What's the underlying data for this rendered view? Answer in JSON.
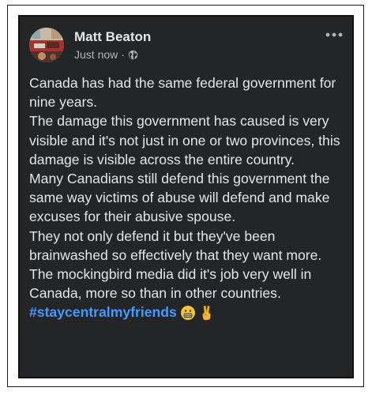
{
  "post": {
    "author": "Matt Beaton",
    "timestamp": "Just now",
    "separator": "·",
    "privacy_icon": "globe-icon",
    "more_icon": "more-dots-icon",
    "paragraphs": [
      "Canada has had the same federal government for nine years.",
      "The damage this government has caused is very visible and it's not just in one or two provinces, this damage is visible across the entire country.",
      "Many Canadians still defend this government the same way victims of abuse will defend and make excuses for their abusive spouse.",
      "They not only defend it but they've been brainwashed so effectively that they want more.",
      "The mockingbird media did it's job very well in Canada, more so than in other countries."
    ],
    "hashtag": "#staycentralmyfriends",
    "emojis": [
      "grimacing-face-icon",
      "victory-hand-icon"
    ]
  },
  "colors": {
    "post_background": "#242526",
    "text": "#e4e6eb",
    "secondary_text": "#b0b3b8",
    "hashtag": "#4599ff"
  }
}
